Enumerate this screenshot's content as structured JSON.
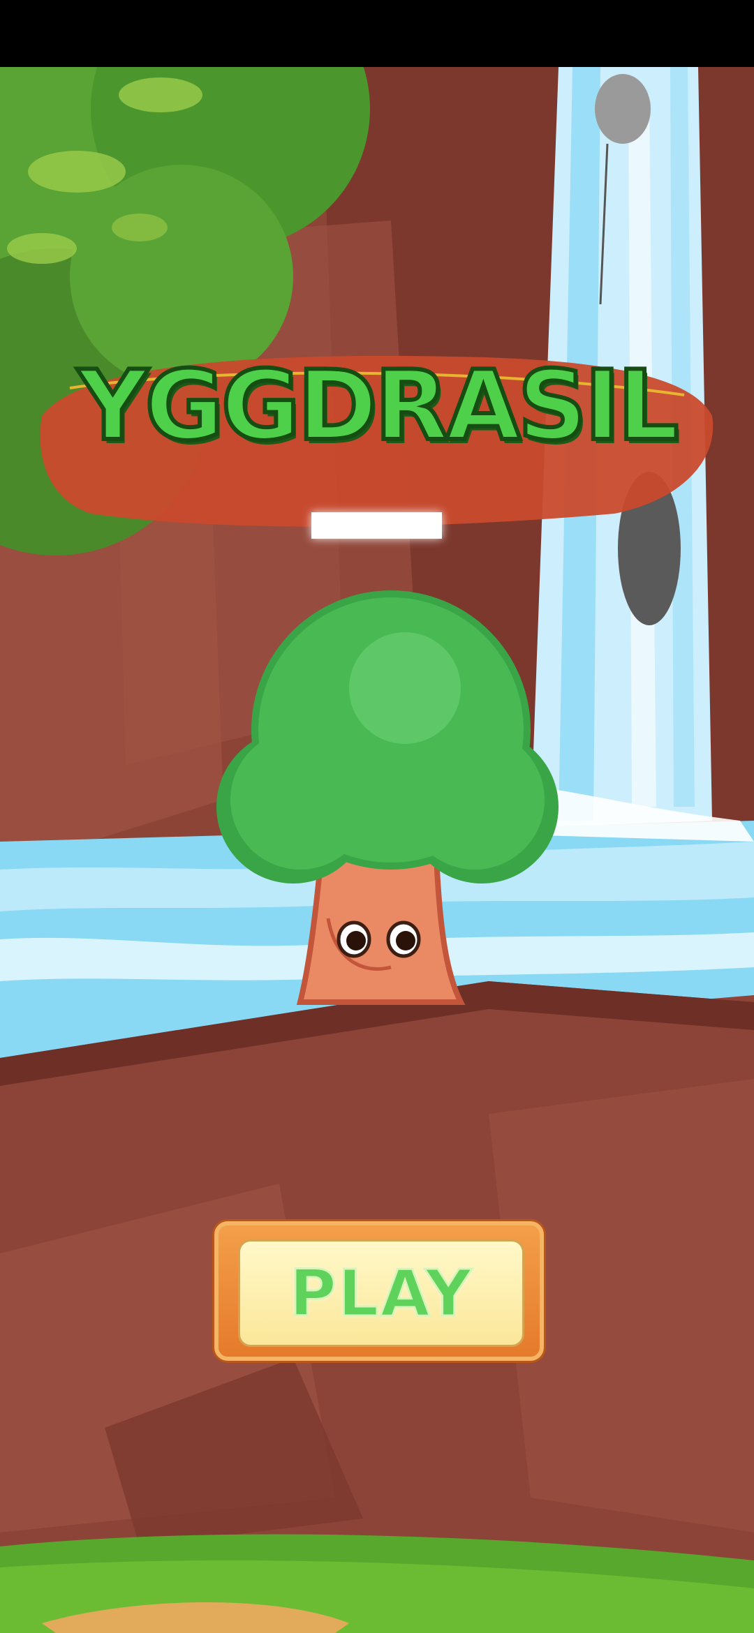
{
  "game": {
    "title": "YGGDRASIL",
    "play_label": "PLAY"
  },
  "colors": {
    "title_green": "#4fd04a",
    "title_banner": "#c94a2d",
    "button_orange": "#e4792a",
    "button_face": "#fbe79a",
    "water": "#7fd7f6",
    "rock": "#8b4336",
    "foliage": "#3dae4a"
  },
  "icons": [
    "tree-character-icon",
    "waterfall-icon",
    "rock-icon"
  ]
}
